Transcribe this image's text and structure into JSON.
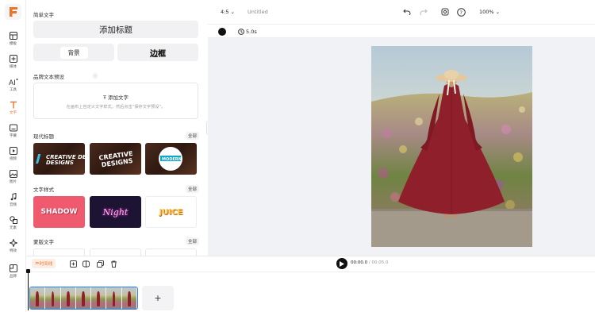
{
  "topbar": {
    "ratio_label": "4:5",
    "doc_title": "Untitled",
    "zoom_label": "100%"
  },
  "rail": {
    "items": [
      {
        "label": "模板",
        "icon": "template-icon"
      },
      {
        "label": "媒体",
        "icon": "media-icon"
      },
      {
        "label": "工具",
        "icon": "ai-tools-icon"
      },
      {
        "label": "文字",
        "icon": "text-icon"
      },
      {
        "label": "字幕",
        "icon": "subtitle-icon"
      },
      {
        "label": "视频",
        "icon": "video-icon"
      },
      {
        "label": "图片",
        "icon": "image-icon"
      },
      {
        "label": "音频",
        "icon": "audio-icon"
      },
      {
        "label": "元素",
        "icon": "elements-icon"
      },
      {
        "label": "特效",
        "icon": "effects-icon"
      },
      {
        "label": "品牌",
        "icon": "brand-icon"
      }
    ],
    "active_index": 3
  },
  "panel": {
    "simple_text_title": "简单文字",
    "add_heading": "添加标题",
    "background_label": "背景",
    "border_label": "边框",
    "brand_preset_title": "品牌文本预设",
    "add_text": "添加文字",
    "brand_hint": "在画布上自定义文字样式，然后点击“保存文字预设”。",
    "modern_title": "现代标题",
    "text_style_title": "文字样式",
    "template_text_title": "蒙版文字",
    "all_label": "全部",
    "thumbs_modern": [
      "CREATIVE DESIGNS",
      "CREATIVE DESIGNS",
      "MODERN"
    ],
    "thumbs_style": [
      "SHADOW",
      "Night",
      "JUICE"
    ]
  },
  "canvas": {
    "duration": "5.0s"
  },
  "timeline": {
    "timeline_label": "时间线",
    "current_time": "00:00.0",
    "total_time": "/ 00:05.0",
    "add_symbol": "+"
  },
  "colors": {
    "accent": "#e8772e",
    "selection": "#2b7de9",
    "dress": "#8e1f2b"
  }
}
